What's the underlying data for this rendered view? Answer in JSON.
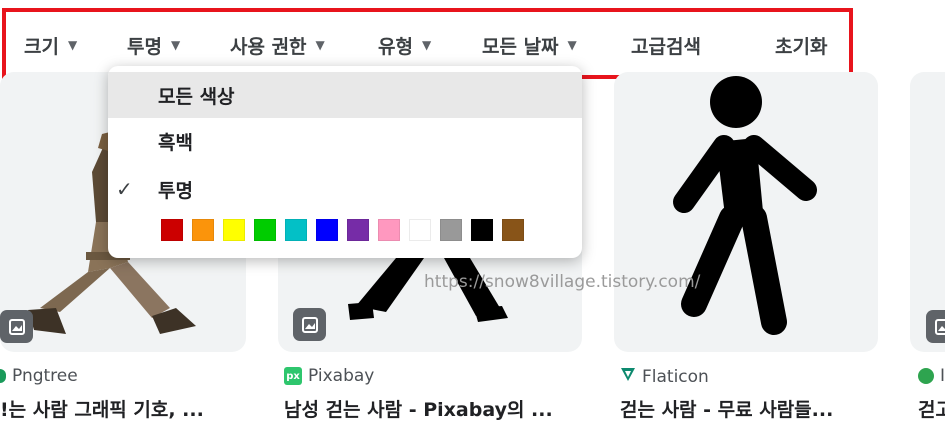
{
  "toolbar": {
    "items": [
      {
        "label": "크기",
        "caret": "▼"
      },
      {
        "label": "투명",
        "caret": "▼"
      },
      {
        "label": "사용 권한",
        "caret": "▼"
      },
      {
        "label": "유형",
        "caret": "▼"
      },
      {
        "label": "모든 날짜",
        "caret": "▼"
      },
      {
        "label": "고급검색"
      },
      {
        "label": "초기화"
      }
    ],
    "highlight_color": "#e8141c"
  },
  "color_menu": {
    "items": [
      {
        "label": "모든 색상",
        "selected": false,
        "hovered": true
      },
      {
        "label": "흑백",
        "selected": false
      },
      {
        "label": "투명",
        "selected": true
      }
    ],
    "check_glyph": "✓",
    "swatches": [
      "#cc0000",
      "#fb940b",
      "#ffff00",
      "#00cc00",
      "#03c0c6",
      "#0000ff",
      "#762ca7",
      "#ff98bf",
      "#ffffff",
      "#999999",
      "#000000",
      "#885418"
    ]
  },
  "results": [
    {
      "source": "Pngtree",
      "title": "!는 사람 그래픽 기호, ...",
      "source_icon": "pngtree-icon"
    },
    {
      "source": "Pixabay",
      "title": "남성 걷는 사람 - Pixabay의 ...",
      "source_icon": "pixabay-icon",
      "icon_text": "px"
    },
    {
      "source": "Flaticon",
      "title": "걷는 사람 - 무료 사람들...",
      "source_icon": "flaticon-icon"
    },
    {
      "source": "I",
      "title": "걷고",
      "source_icon": "generic-site-icon"
    }
  ],
  "watermark": "https://snow8village.tistory.com/"
}
